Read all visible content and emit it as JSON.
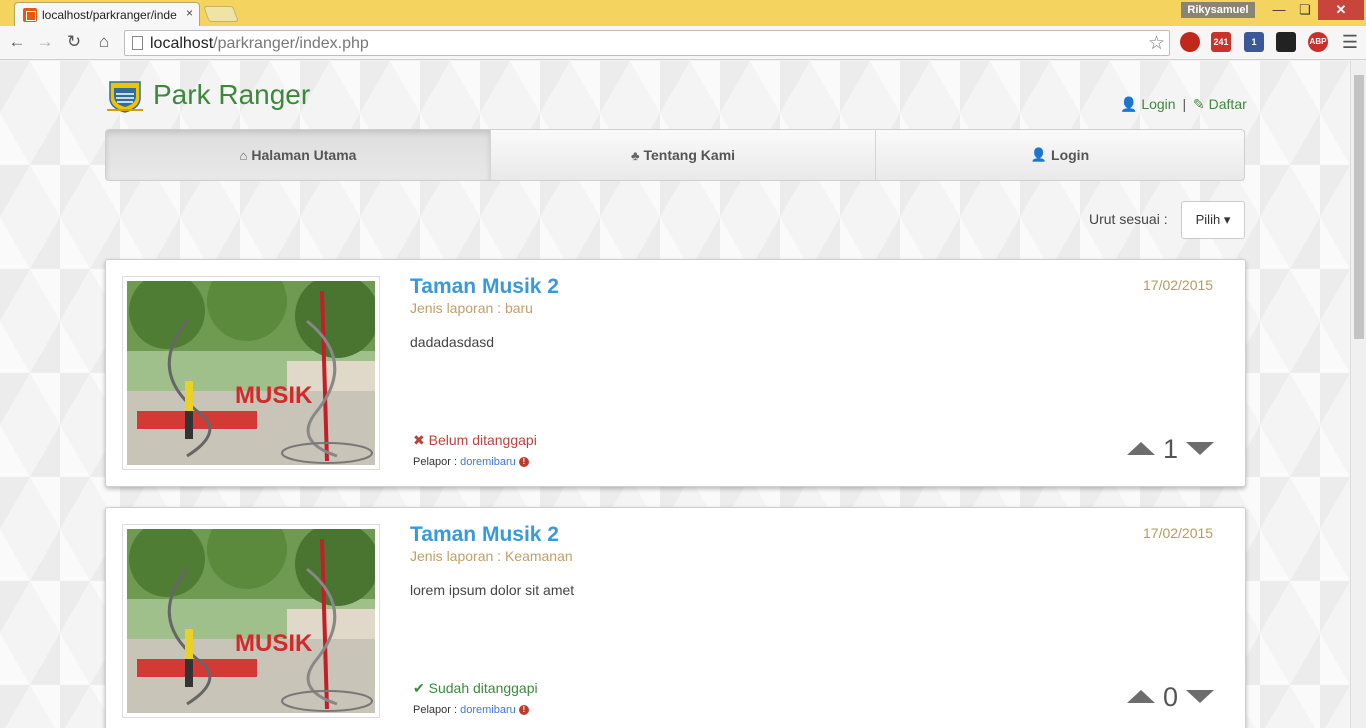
{
  "browser": {
    "tab_title": "localhost/parkranger/inde",
    "tab_close": "×",
    "user_name": "Rikysamuel",
    "url_host": "localhost",
    "url_path": "/parkranger/index.php",
    "extensions": [
      {
        "name": "opera-icon",
        "label": ""
      },
      {
        "name": "gmail-icon",
        "label": "241"
      },
      {
        "name": "facebook-icon",
        "label": "1"
      },
      {
        "name": "extension-icon",
        "label": ""
      },
      {
        "name": "adblock-icon",
        "label": "ABP"
      }
    ]
  },
  "site": {
    "title": "Park Ranger",
    "login_link": "Login",
    "separator": "|",
    "register_link": "Daftar"
  },
  "nav": {
    "home": "Halaman Utama",
    "about": "Tentang Kami",
    "login": "Login"
  },
  "sort": {
    "label": "Urut sesuai :",
    "button": "Pilih"
  },
  "reports": [
    {
      "title": "Taman Musik 2",
      "type": "Jenis laporan : baru",
      "description": "dadadasdasd",
      "date": "17/02/2015",
      "status": "Belum ditanggapi",
      "reporter_label": "Pelapor :",
      "reporter": "doremibaru",
      "votes": "1"
    },
    {
      "title": "Taman Musik 2",
      "type": "Jenis laporan : Keamanan",
      "description": "lorem ipsum dolor sit amet",
      "date": "17/02/2015",
      "status": "Sudah ditanggapi",
      "reporter_label": "Pelapor :",
      "reporter": "doremibaru",
      "votes": "0"
    }
  ],
  "colors": {
    "brand_green": "#3b8a3a",
    "title_blue": "#3a9ad9",
    "date_tan": "#b99a5f",
    "status_red": "#b9433d"
  }
}
